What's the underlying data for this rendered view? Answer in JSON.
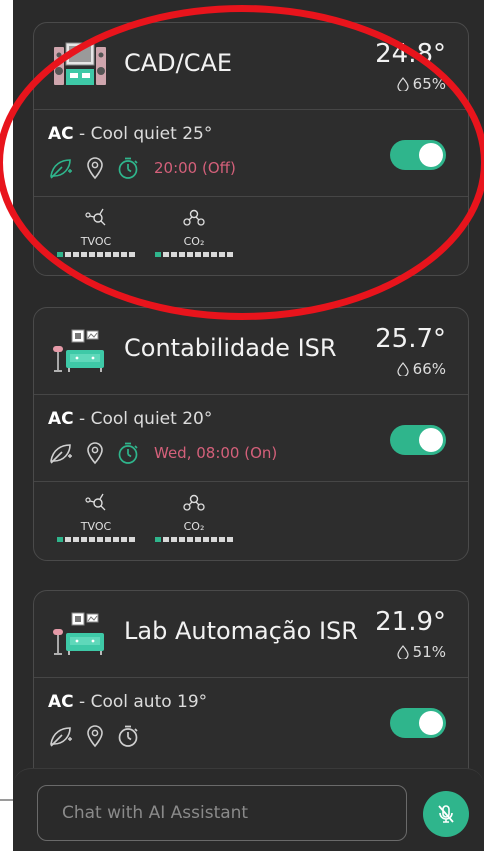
{
  "rooms": [
    {
      "name": "CAD/CAE",
      "temperature": "24.8°",
      "humidity": "65%",
      "ac_label": "AC",
      "ac_mode": " - Cool quiet 25°",
      "schedule": "20:00 (Off)",
      "ac_on": true,
      "sensors": [
        {
          "label": "TVOC",
          "level": 1,
          "segments": 10
        },
        {
          "label": "CO₂",
          "level": 1,
          "segments": 10
        }
      ]
    },
    {
      "name": "Contabilidade ISR",
      "temperature": "25.7°",
      "humidity": "66%",
      "ac_label": "AC",
      "ac_mode": " - Cool quiet 20°",
      "schedule": "Wed, 08:00 (On)",
      "ac_on": true,
      "sensors": [
        {
          "label": "TVOC",
          "level": 1,
          "segments": 10
        },
        {
          "label": "CO₂",
          "level": 1,
          "segments": 10
        }
      ]
    },
    {
      "name": "Lab Automação ISR",
      "temperature": "21.9°",
      "humidity": "51%",
      "ac_label": "AC",
      "ac_mode": " - Cool auto 19°",
      "schedule": "",
      "ac_on": true,
      "sensors": []
    }
  ],
  "chat": {
    "placeholder": "Chat with AI Assistant"
  },
  "colors": {
    "accent": "#2fb58c",
    "schedule": "#d4607a",
    "highlight_ring": "#e8141c"
  }
}
